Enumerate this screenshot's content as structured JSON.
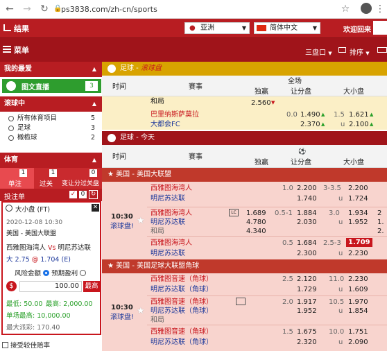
{
  "browser": {
    "url": "ps3838.com/zh-cn/sports"
  },
  "header": {
    "results_label": "结果",
    "region_select": "亚洲",
    "language_select": "简体中文",
    "welcome_text": "欢迎回来",
    "menu_label": "菜单",
    "market_select": "三盘口",
    "sort_select": "排序"
  },
  "sidebar": {
    "favorites_title": "我的最爱",
    "live_stream_label": "图文直播",
    "live_stream_count": "3",
    "inplay_title": "滚球中",
    "inplay_items": [
      {
        "label": "所有体育项目",
        "count": "5"
      },
      {
        "label": "足球",
        "count": "3"
      },
      {
        "label": "橄榄球",
        "count": "2"
      }
    ],
    "sports_title": "体育",
    "bet_tabs": [
      {
        "label": "单注",
        "badge": "1"
      },
      {
        "label": "过关",
        "badge": "1"
      },
      {
        "label": "变让分过关盘",
        "badge": "0"
      }
    ],
    "betslip_label": "投注单",
    "betslip_count": "0",
    "bet": {
      "market": "大小盘 (FT)",
      "datetime": "2020-12-08 10:30",
      "league": "美国 - 美国大联盟",
      "home": "西雅图海湾人",
      "vs": "Vs",
      "away": "明尼苏达联",
      "selection": "大 2.75",
      "at": "@",
      "odds": "1.704",
      "odds_type": "(E)",
      "option_risk": "风险金额",
      "option_win": "预期盈利",
      "currency": "$",
      "amount": "100.00",
      "max_btn": "最高",
      "min_label": "最低: 50.00",
      "max_label": "最高: 2,000.00",
      "single_max": "单场最高: 10,000.00",
      "max_win": "最大派彩: 170.40"
    },
    "accept_better_odds": "接受较佳赔率"
  },
  "main": {
    "col_time": "时间",
    "col_event": "赛事",
    "col_fulltime": "全场",
    "col_1x2": "独赢",
    "col_hdp": "让分盘",
    "col_ou": "大小盘",
    "section_live": {
      "sport": "足球",
      "title": "滚球盘"
    },
    "live_rows": [
      {
        "event": "和局",
        "odds_1x2": "2.560"
      },
      {
        "home": "巴里纳斯萨莫拉",
        "away": "大都会FC",
        "hdp_line": "0.0",
        "hdp_home": "1.490",
        "hdp_away": "2.370",
        "ou_line": "1.5",
        "ou_over": "1.621",
        "ou_under": "2.100",
        "u": "u"
      }
    ],
    "section_today": {
      "sport": "足球",
      "title": "今天"
    },
    "league1": "美国 - 美国大联盟",
    "match1": {
      "time": "10:30",
      "status": "滚球盘!",
      "rows": [
        {
          "home": "西雅图海湾人",
          "away": "明尼苏达联",
          "hdp_line": "1.0",
          "hdp_home": "2.200",
          "hdp_away": "1.740",
          "ou_line": "3-3.5",
          "ou_over": "2.200",
          "ou_under": "1.724",
          "u": "u"
        },
        {
          "home": "西雅图海湾人",
          "away": "明尼苏达联",
          "draw": "和局",
          "x_home": "1.689",
          "x_away": "4.780",
          "x_draw": "4.340",
          "hdp_line": "0.5-1",
          "hdp_home": "1.884",
          "hdp_away": "2.030",
          "ou_line": "3.0",
          "ou_over": "1.934",
          "ou_under": "1.952",
          "u": "u",
          "edge1": "2",
          "edge2": "1.",
          "edge3": "2."
        },
        {
          "home": "西雅图海湾人",
          "away": "明尼苏达联",
          "hdp_line": "0.5",
          "hdp_home": "1.684",
          "hdp_away": "2.300",
          "ou_line": "2.5-3",
          "ou_over": "1.709",
          "ou_under": "2.230",
          "u": "u"
        }
      ]
    },
    "league2": "美国 - 美国足球大联盟角球",
    "match2": {
      "time": "10:30",
      "status": "滚球盘!",
      "rows": [
        {
          "home": "西雅图音速（角球）",
          "away": "明尼苏达联（角球）",
          "hdp_line": "2.5",
          "hdp_home": "2.120",
          "hdp_away": "1.729",
          "ou_line": "11.0",
          "ou_over": "2.230",
          "ou_under": "1.609",
          "u": "u"
        },
        {
          "home": "西雅图音速（角球）",
          "away": "明尼苏达联（角球）",
          "draw": "和局",
          "hdp_line": "2.0",
          "hdp_home": "1.917",
          "hdp_away": "1.952",
          "ou_line": "10.5",
          "ou_over": "1.970",
          "ou_under": "1.854",
          "u": "u"
        },
        {
          "home": "西雅图音速（角球）",
          "away": "明尼苏达联（角球）",
          "hdp_line": "1.5",
          "hdp_home": "1.675",
          "hdp_away": "2.320",
          "ou_line": "10.0",
          "ou_over": "1.751",
          "ou_under": "2.090",
          "u": "u"
        }
      ]
    }
  },
  "colors": {
    "brand_red": "#b81d22",
    "dark_red": "#a0141a",
    "live_orange": "#d8a300",
    "pink_row": "#f8d4ce",
    "yellow_row": "#fbefc6"
  }
}
